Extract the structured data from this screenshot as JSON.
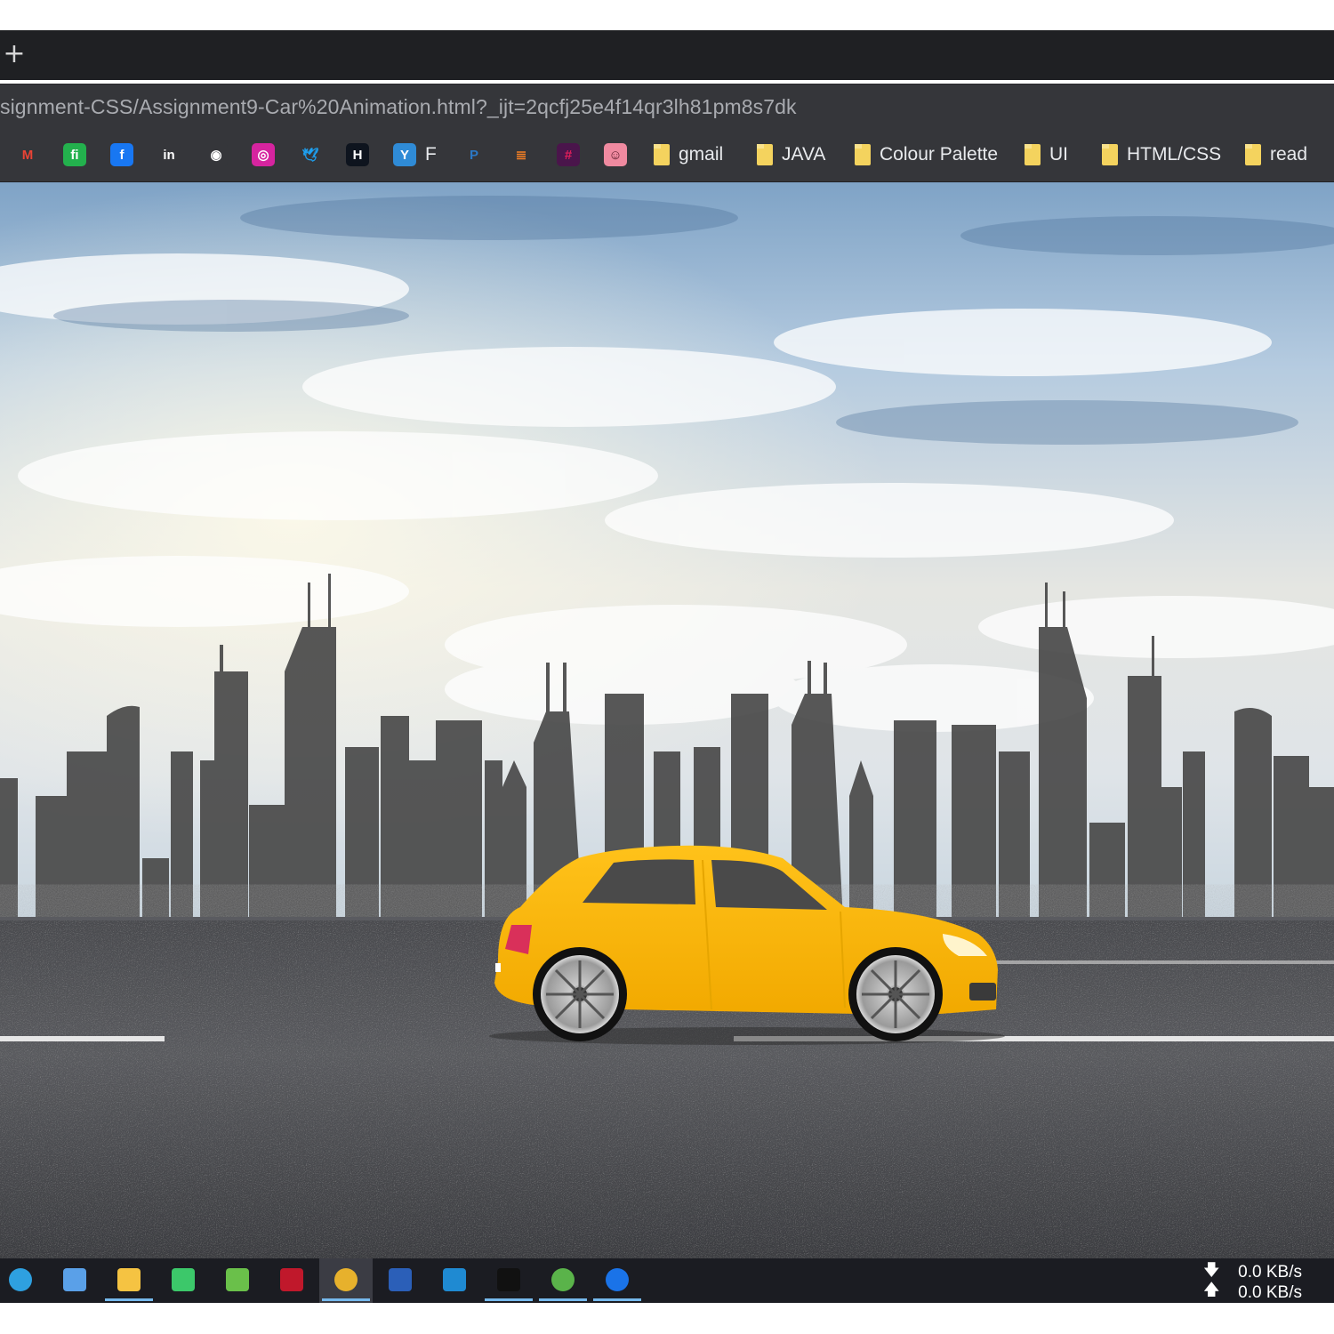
{
  "browser": {
    "new_tab_symbol": "+",
    "address_url": "signment-CSS/Assignment9-Car%20Animation.html?_ijt=2qcfj25e4f14qr3lh81pm8s7dk",
    "bookmark_icons": [
      {
        "name": "gmail-icon",
        "glyph": "M",
        "color": "#ea4335",
        "bg": "transparent"
      },
      {
        "name": "fi-icon",
        "glyph": "fi",
        "color": "#ffffff",
        "bg": "#23b14d"
      },
      {
        "name": "facebook-icon",
        "glyph": "f",
        "color": "#ffffff",
        "bg": "#1877f2"
      },
      {
        "name": "linkedin-icon",
        "glyph": "in",
        "color": "#ffffff",
        "bg": "#35363a"
      },
      {
        "name": "github-icon",
        "glyph": "◉",
        "color": "#ffffff",
        "bg": "#35363a"
      },
      {
        "name": "instagram-icon",
        "glyph": "◎",
        "color": "#ffffff",
        "bg": "#d6249f"
      },
      {
        "name": "twitter-icon",
        "glyph": "🕊",
        "color": "#1da1f2",
        "bg": "transparent"
      },
      {
        "name": "hackerrank-icon",
        "glyph": "H",
        "color": "#ffffff",
        "bg": "#0e141e"
      },
      {
        "name": "yammer-icon",
        "glyph": "Y",
        "color": "#ffffff",
        "bg": "#2f8bd6"
      },
      {
        "name": "paypal-icon",
        "glyph": "P",
        "color": "#2b78c5",
        "bg": "transparent"
      },
      {
        "name": "stackoverflow-icon",
        "glyph": "≣",
        "color": "#f48024",
        "bg": "transparent"
      },
      {
        "name": "slack-icon",
        "glyph": "#",
        "color": "#e01e5a",
        "bg": "#4a154b"
      },
      {
        "name": "app-icon",
        "glyph": "☺",
        "color": "#5a1a2a",
        "bg": "#f08aa0"
      }
    ],
    "bookmark_f_label": "F",
    "bookmark_folders": [
      "gmail",
      "JAVA",
      "Colour Palette",
      "UI",
      "HTML/CSS",
      "read"
    ]
  },
  "taskbar": {
    "apps": [
      {
        "name": "edge-icon",
        "color": "#2ea0e0"
      },
      {
        "name": "remote-desktop-icon",
        "color": "#5aa0e8"
      },
      {
        "name": "file-explorer-icon",
        "color": "#f5c342"
      },
      {
        "name": "green-app-icon",
        "color": "#3cc86a"
      },
      {
        "name": "notepad-chart-icon",
        "color": "#6ac04a"
      },
      {
        "name": "red-app-icon",
        "color": "#c0182b"
      },
      {
        "name": "chrome-icon",
        "color": "#e7b12c"
      },
      {
        "name": "word-app-icon",
        "color": "#2b5fb8"
      },
      {
        "name": "vscode-icon",
        "color": "#1f8ad2"
      },
      {
        "name": "intellij-icon",
        "color": "#111111"
      },
      {
        "name": "green-round-app-icon",
        "color": "#5ab34a"
      },
      {
        "name": "teamviewer-icon",
        "color": "#1a73e8"
      }
    ],
    "net_down": "0.0 KB/s",
    "net_up": "0.0 KB/s"
  }
}
